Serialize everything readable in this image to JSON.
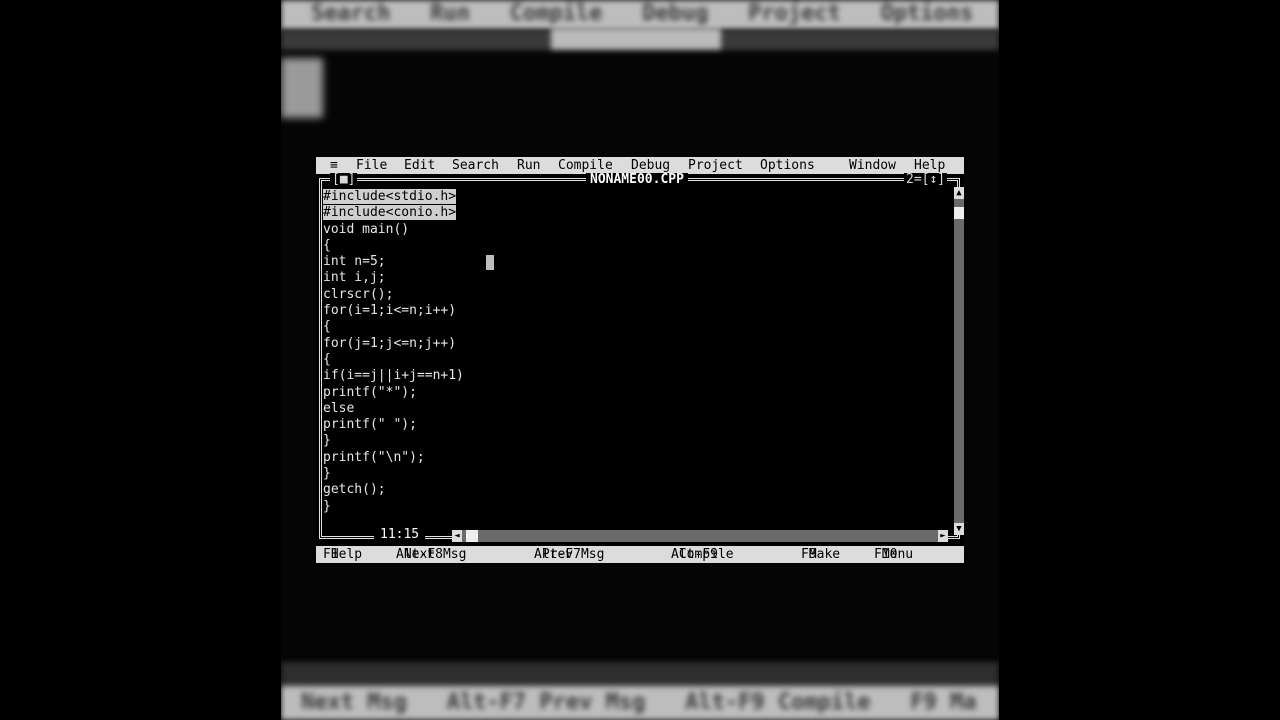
{
  "background": {
    "menu_text": "Search   Run   Compile   Debug   Project   Options",
    "status_text": "Next Msg   Alt-F7 Prev Msg   Alt-F9 Compile   F9 Ma"
  },
  "menu": {
    "system": "≡",
    "items": [
      "File",
      "Edit",
      "Search",
      "Run",
      "Compile",
      "Debug",
      "Project",
      "Options",
      "Window",
      "Help"
    ]
  },
  "window": {
    "close_box": "[■]",
    "title": "NONAME00.CPP",
    "number": "2=[↕]",
    "position": "11:15"
  },
  "code_lines": [
    "#include<stdio.h>",
    "#include<conio.h>",
    "void main()",
    "{",
    "int n=5;",
    "int i,j;",
    "clrscr();",
    "for(i=1;i<=n;i++)",
    "{",
    "for(j=1;j<=n;j++)",
    "{",
    "if(i==j||i+j==n+1)",
    "printf(\"*\");",
    "else",
    "printf(\" \");",
    "}",
    "printf(\"\\n\");",
    "}",
    "getch();",
    "}"
  ],
  "status_bar": {
    "items": [
      {
        "key": "F1",
        "label": "Help"
      },
      {
        "key": "Alt-F8",
        "label": "Next Msg"
      },
      {
        "key": "Alt-F7",
        "label": "Prev Msg"
      },
      {
        "key": "Alt-F9",
        "label": "Compile"
      },
      {
        "key": "F9",
        "label": "Make"
      },
      {
        "key": "F10",
        "label": "Menu"
      }
    ]
  },
  "icons": {
    "scroll_up": "▲",
    "scroll_down": "▼",
    "scroll_left": "◄",
    "scroll_right": "►"
  }
}
